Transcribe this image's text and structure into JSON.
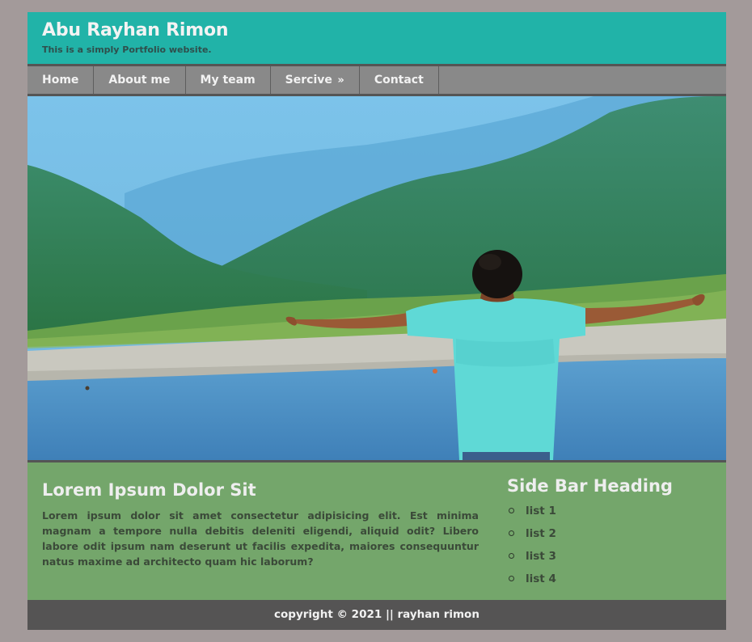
{
  "header": {
    "title": "Abu Rayhan Rimon",
    "tagline": "This is a simply Portfolio website."
  },
  "nav": {
    "items": [
      {
        "label": "Home"
      },
      {
        "label": "About me"
      },
      {
        "label": "My team"
      },
      {
        "label": "Sercive",
        "icon": "double-chevron-right-icon"
      },
      {
        "label": "Contact"
      }
    ]
  },
  "hero": {
    "image": "person-with-outstretched-arms-by-river-photo"
  },
  "main": {
    "heading": "Lorem Ipsum Dolor Sit",
    "text": "Lorem ipsum dolor sit amet consectetur adipisicing elit. Est minima magnam a tempore nulla debitis deleniti eligendi, aliquid odit? Libero labore odit ipsum nam deserunt ut facilis expedita, maiores consequuntur natus maxime ad architecto quam hic laborum?"
  },
  "sidebar": {
    "heading": "Side Bar Heading",
    "items": [
      "list 1",
      "list 2",
      "list 3",
      "list 4"
    ]
  },
  "footer": {
    "text": "copyright © 2021 || rayhan rimon"
  },
  "colors": {
    "background": "#a39a9a",
    "header": "#21b3a8",
    "nav": "#898989",
    "content": "#74a66b",
    "footer": "#555454"
  }
}
